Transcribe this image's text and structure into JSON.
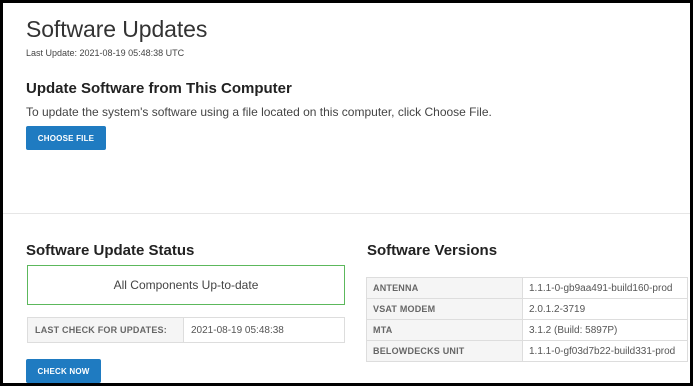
{
  "page": {
    "title": "Software Updates",
    "last_update": "Last Update: 2021-08-19 05:48:38 UTC"
  },
  "upload": {
    "heading": "Update Software from This Computer",
    "description": "To update the system's software using a file located on this computer, click Choose File.",
    "choose_file_label": "CHOOSE FILE"
  },
  "status": {
    "heading": "Software Update Status",
    "message": "All Components Up-to-date",
    "last_check_label": "LAST CHECK FOR UPDATES:",
    "last_check_value": "2021-08-19 05:48:38",
    "check_now_label": "CHECK NOW"
  },
  "versions": {
    "heading": "Software Versions",
    "rows": [
      {
        "component": "ANTENNA",
        "version": "1.1.1-0-gb9aa491-build160-prod"
      },
      {
        "component": "VSAT MODEM",
        "version": "2.0.1.2-3719"
      },
      {
        "component": "MTA",
        "version": "3.1.2 (Build: 5897P)"
      },
      {
        "component": "BELOWDECKS UNIT",
        "version": "1.1.1-0-gf03d7b22-build331-prod"
      }
    ]
  },
  "colors": {
    "button": "#1f7bc1",
    "status_border": "#5cb85c"
  }
}
